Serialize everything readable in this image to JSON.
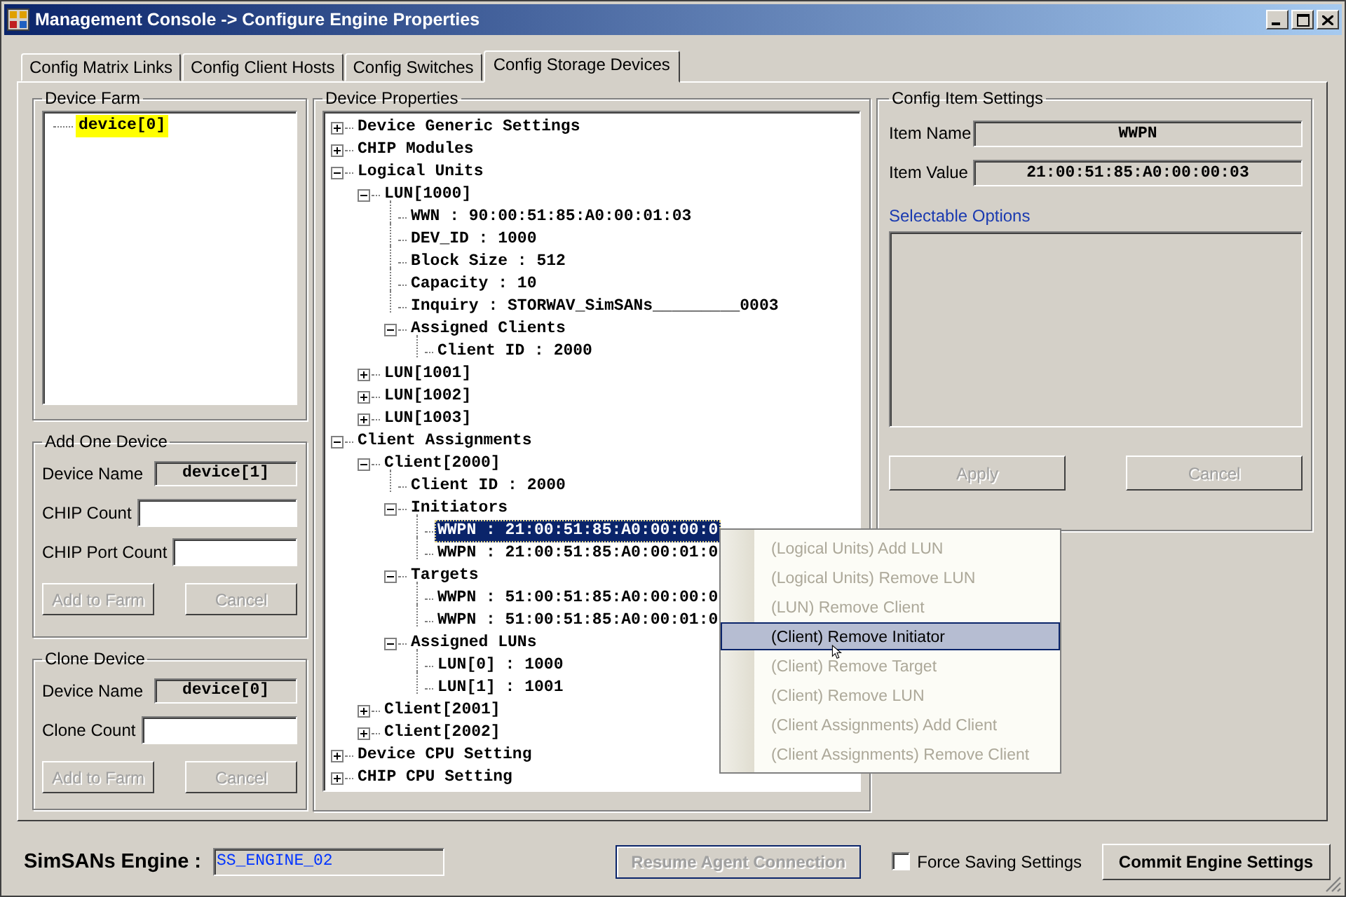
{
  "window": {
    "title": "Management Console -> Configure Engine Properties"
  },
  "tabs": [
    {
      "label": "Config Matrix Links",
      "selected": false
    },
    {
      "label": "Config Client Hosts",
      "selected": false
    },
    {
      "label": "Config Switches",
      "selected": false
    },
    {
      "label": "Config Storage Devices",
      "selected": true
    }
  ],
  "device_farm": {
    "title": "Device Farm",
    "items": [
      {
        "label": "device[0]",
        "selected": true
      }
    ]
  },
  "add_one_device": {
    "title": "Add One Device",
    "fields": [
      {
        "label": "Device Name",
        "kind": "readonly",
        "value": "device[1]"
      },
      {
        "label": "CHIP Count",
        "kind": "input"
      },
      {
        "label": "CHIP Port Count",
        "kind": "input"
      }
    ],
    "buttons": [
      {
        "label": "Add to Farm",
        "disabled": true
      },
      {
        "label": "Cancel",
        "disabled": true
      }
    ]
  },
  "clone_device": {
    "title": "Clone Device",
    "fields": [
      {
        "label": "Device Name",
        "kind": "readonly",
        "value": "device[0]"
      },
      {
        "label": "Clone Count",
        "kind": "input"
      }
    ],
    "buttons": [
      {
        "label": "Add to Farm",
        "disabled": true
      },
      {
        "label": "Cancel",
        "disabled": true
      }
    ]
  },
  "device_properties": {
    "title": "Device Properties",
    "tree": [
      {
        "label": "Device Generic Settings",
        "expanded": false,
        "selected": false
      },
      {
        "label": "CHIP Modules",
        "expanded": false,
        "selected": false
      },
      {
        "label": "Logical Units",
        "expanded": true,
        "selected": false,
        "children": [
          {
            "label": "LUN[1000]",
            "expanded": true,
            "selected": false,
            "children": [
              {
                "label": "WWN : 90:00:51:85:A0:00:01:03",
                "selected": false
              },
              {
                "label": "DEV_ID : 1000",
                "selected": false
              },
              {
                "label": "Block Size : 512",
                "selected": false
              },
              {
                "label": "Capacity : 10",
                "selected": false
              },
              {
                "label": "Inquiry : STORWAV_SimSANs_________0003",
                "selected": false
              },
              {
                "label": "Assigned Clients",
                "expanded": true,
                "selected": false,
                "children": [
                  {
                    "label": "Client ID : 2000",
                    "selected": false
                  }
                ]
              }
            ]
          },
          {
            "label": "LUN[1001]",
            "expanded": false,
            "selected": false
          },
          {
            "label": "LUN[1002]",
            "expanded": false,
            "selected": false
          },
          {
            "label": "LUN[1003]",
            "expanded": false,
            "selected": false
          }
        ]
      },
      {
        "label": "Client Assignments",
        "expanded": true,
        "selected": false,
        "children": [
          {
            "label": "Client[2000]",
            "expanded": true,
            "selected": false,
            "children": [
              {
                "label": "Client ID : 2000",
                "selected": false
              },
              {
                "label": "Initiators",
                "expanded": true,
                "selected": false,
                "children": [
                  {
                    "label": "WWPN : 21:00:51:85:A0:00:00:0",
                    "selected": true
                  },
                  {
                    "label": "WWPN : 21:00:51:85:A0:00:01:0",
                    "selected": false
                  }
                ]
              },
              {
                "label": "Targets",
                "expanded": true,
                "selected": false,
                "children": [
                  {
                    "label": "WWPN : 51:00:51:85:A0:00:00:0",
                    "selected": false
                  },
                  {
                    "label": "WWPN : 51:00:51:85:A0:00:01:0",
                    "selected": false
                  }
                ]
              },
              {
                "label": "Assigned LUNs",
                "expanded": true,
                "selected": false,
                "children": [
                  {
                    "label": "LUN[0] : 1000",
                    "selected": false
                  },
                  {
                    "label": "LUN[1] : 1001",
                    "selected": false
                  }
                ]
              }
            ]
          },
          {
            "label": "Client[2001]",
            "expanded": false,
            "selected": false
          },
          {
            "label": "Client[2002]",
            "expanded": false,
            "selected": false
          }
        ]
      },
      {
        "label": "Device CPU Setting",
        "expanded": false,
        "selected": false
      },
      {
        "label": "CHIP CPU Setting",
        "expanded": false,
        "selected": false
      }
    ]
  },
  "config_item_settings": {
    "title": "Config Item Settings",
    "fields": [
      {
        "label": "Item Name",
        "value": "WWPN"
      },
      {
        "label": "Item Value",
        "value": "21:00:51:85:A0:00:00:03"
      }
    ],
    "options_label": "Selectable Options",
    "buttons": [
      {
        "label": "Apply",
        "disabled": true
      },
      {
        "label": "Cancel",
        "disabled": true
      }
    ]
  },
  "context_menu": {
    "items": [
      {
        "label": "(Logical Units) Add LUN",
        "disabled": true,
        "selected": false
      },
      {
        "label": "(Logical Units) Remove LUN",
        "disabled": true,
        "selected": false
      },
      {
        "label": "(LUN) Remove Client",
        "disabled": true,
        "selected": false
      },
      {
        "label": "(Client) Remove Initiator",
        "disabled": false,
        "selected": true
      },
      {
        "label": "(Client) Remove Target",
        "disabled": true,
        "selected": false
      },
      {
        "label": "(Client) Remove LUN",
        "disabled": true,
        "selected": false
      },
      {
        "label": "(Client Assignments) Add Client",
        "disabled": true,
        "selected": false
      },
      {
        "label": "(Client Assignments) Remove Client",
        "disabled": true,
        "selected": false
      }
    ]
  },
  "footer": {
    "engine_label": "SimSANs Engine :",
    "engine_value": "SS_ENGINE_02",
    "resume_button": {
      "label": "Resume Agent Connection",
      "disabled": true
    },
    "force_saving": {
      "label": "Force Saving Settings",
      "checked": false
    },
    "commit_button": {
      "label": "Commit Engine Settings",
      "disabled": false
    }
  }
}
